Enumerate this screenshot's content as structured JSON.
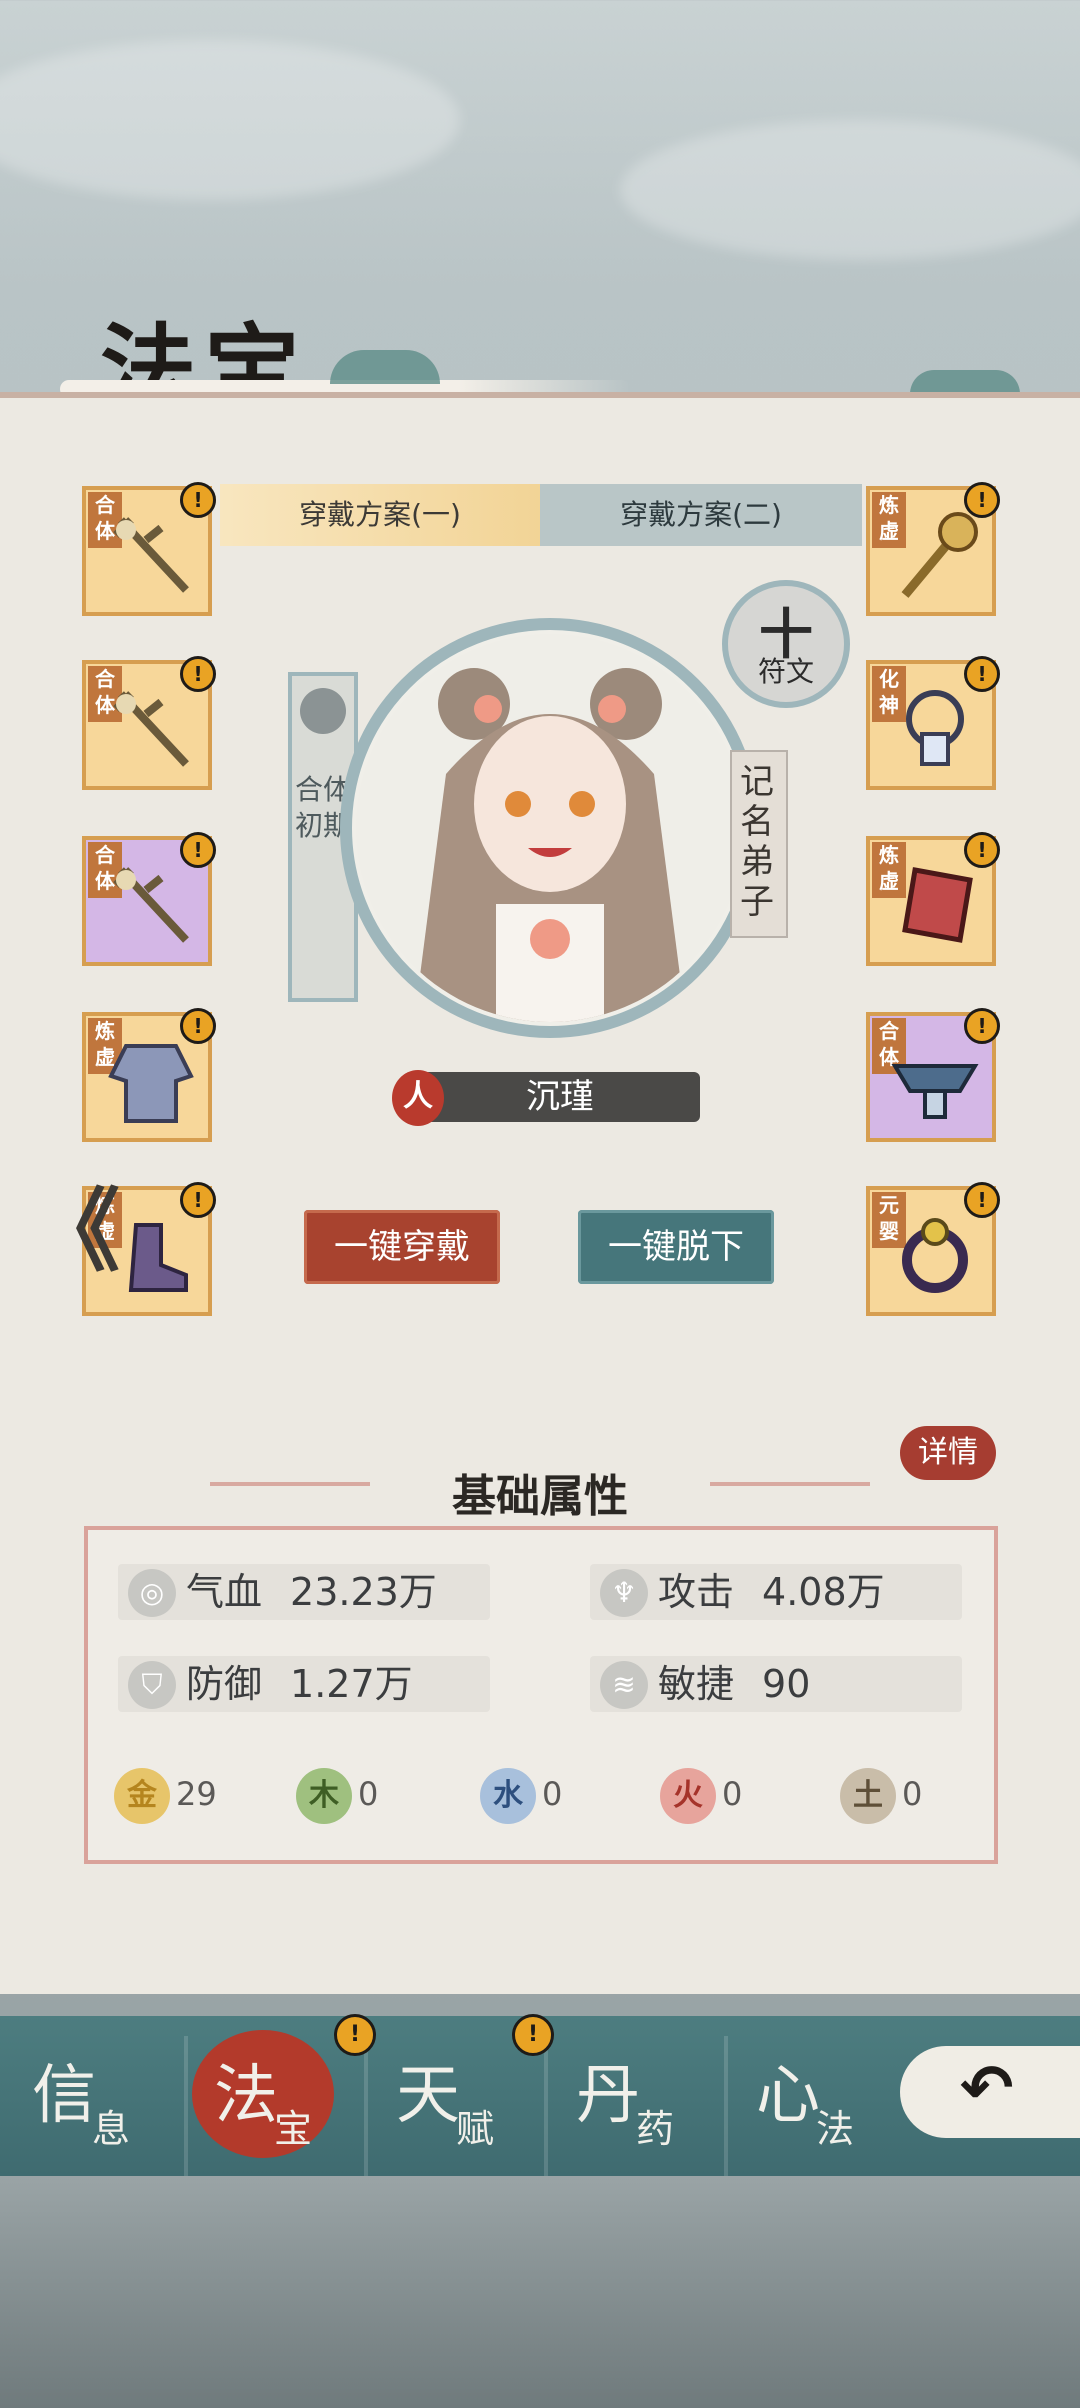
{
  "header": {
    "title": "法宝"
  },
  "plans": {
    "plan1": "穿戴方案(一)",
    "plan2": "穿戴方案(二)"
  },
  "left_slots": [
    {
      "tag": "合体",
      "rarity": "orange",
      "icon": "sword-icon"
    },
    {
      "tag": "合体",
      "rarity": "orange",
      "icon": "sword-icon"
    },
    {
      "tag": "合体",
      "rarity": "purple",
      "icon": "sword-icon"
    },
    {
      "tag": "炼虚",
      "rarity": "orange",
      "icon": "robe-icon"
    },
    {
      "tag": "炼虚",
      "rarity": "orange",
      "icon": "boots-icon"
    }
  ],
  "right_slots": [
    {
      "tag": "炼虚",
      "rarity": "orange",
      "icon": "fan-staff-icon"
    },
    {
      "tag": "化神",
      "rarity": "orange",
      "icon": "necklace-icon"
    },
    {
      "tag": "炼虚",
      "rarity": "orange",
      "icon": "gem-icon"
    },
    {
      "tag": "合体",
      "rarity": "purple",
      "icon": "belt-icon"
    },
    {
      "tag": "元婴",
      "rarity": "orange",
      "icon": "ring-icon"
    }
  ],
  "alert_mark": "!",
  "character": {
    "realm": "合体初期",
    "rank": "记名弟子",
    "race": "人",
    "name": "沉瑾"
  },
  "rune": {
    "plus": "十",
    "label": "符文"
  },
  "actions": {
    "wear_all": "一键穿戴",
    "remove_all": "一键脱下"
  },
  "back_label": "《",
  "attributes": {
    "title": "基础属性",
    "detail": "详情",
    "hp_label": "气血",
    "hp_value": "23.23万",
    "atk_label": "攻击",
    "atk_value": "4.08万",
    "def_label": "防御",
    "def_value": "1.27万",
    "agi_label": "敏捷",
    "agi_value": "90"
  },
  "elements": [
    {
      "symbol": "金",
      "value": "29",
      "color": "#e7c56a"
    },
    {
      "symbol": "木",
      "value": "0",
      "color": "#7ea05c"
    },
    {
      "symbol": "水",
      "value": "0",
      "color": "#6f8fb8"
    },
    {
      "symbol": "火",
      "value": "0",
      "color": "#cf6b5f"
    },
    {
      "symbol": "土",
      "value": "0",
      "color": "#9b8b73"
    }
  ],
  "nav": [
    {
      "big": "信",
      "small": "息"
    },
    {
      "big": "法",
      "small": "宝"
    },
    {
      "big": "天",
      "small": "赋"
    },
    {
      "big": "丹",
      "small": "药"
    },
    {
      "big": "心",
      "small": "法"
    }
  ],
  "return_icon": "↶"
}
